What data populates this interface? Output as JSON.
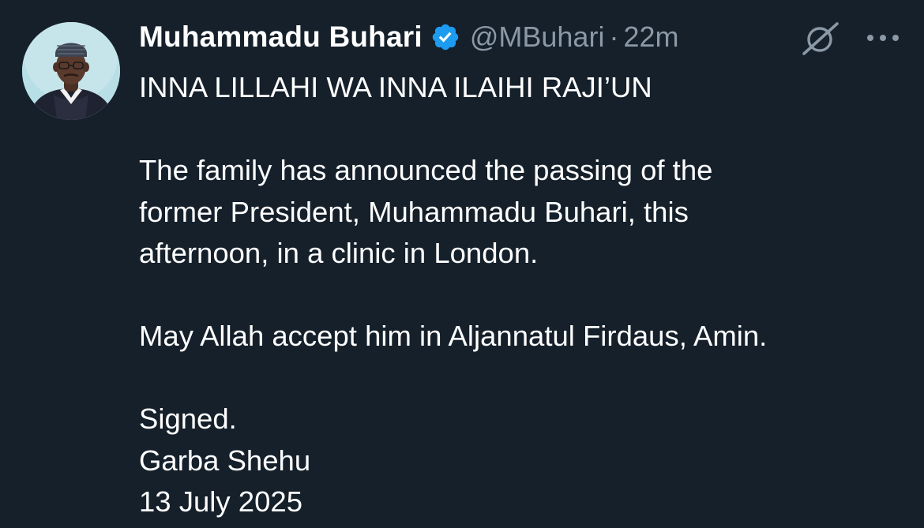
{
  "author": {
    "display_name": "Muhammadu Buhari",
    "handle": "@MBuhari",
    "separator": "·",
    "time": "22m",
    "verified": true
  },
  "icons": {
    "verified": "verified-badge-icon",
    "grok": "grok-icon",
    "more": "more-options-icon",
    "avatar": "avatar"
  },
  "colors": {
    "background": "#15202b",
    "text": "#ffffff",
    "muted": "#8b98a5",
    "verified_badge": "#1d9bf0"
  },
  "tweet": {
    "line1": "INNA LILLAHI WA INNA ILAIHI RAJI’UN",
    "paragraph2": [
      "The family has announced the passing of the",
      "former President, Muhammadu Buhari, this",
      "afternoon, in a clinic in London."
    ],
    "paragraph3": "May Allah accept him in Aljannatul Firdaus, Amin.",
    "signature": [
      "Signed.",
      "Garba Shehu",
      "13 July 2025"
    ]
  }
}
